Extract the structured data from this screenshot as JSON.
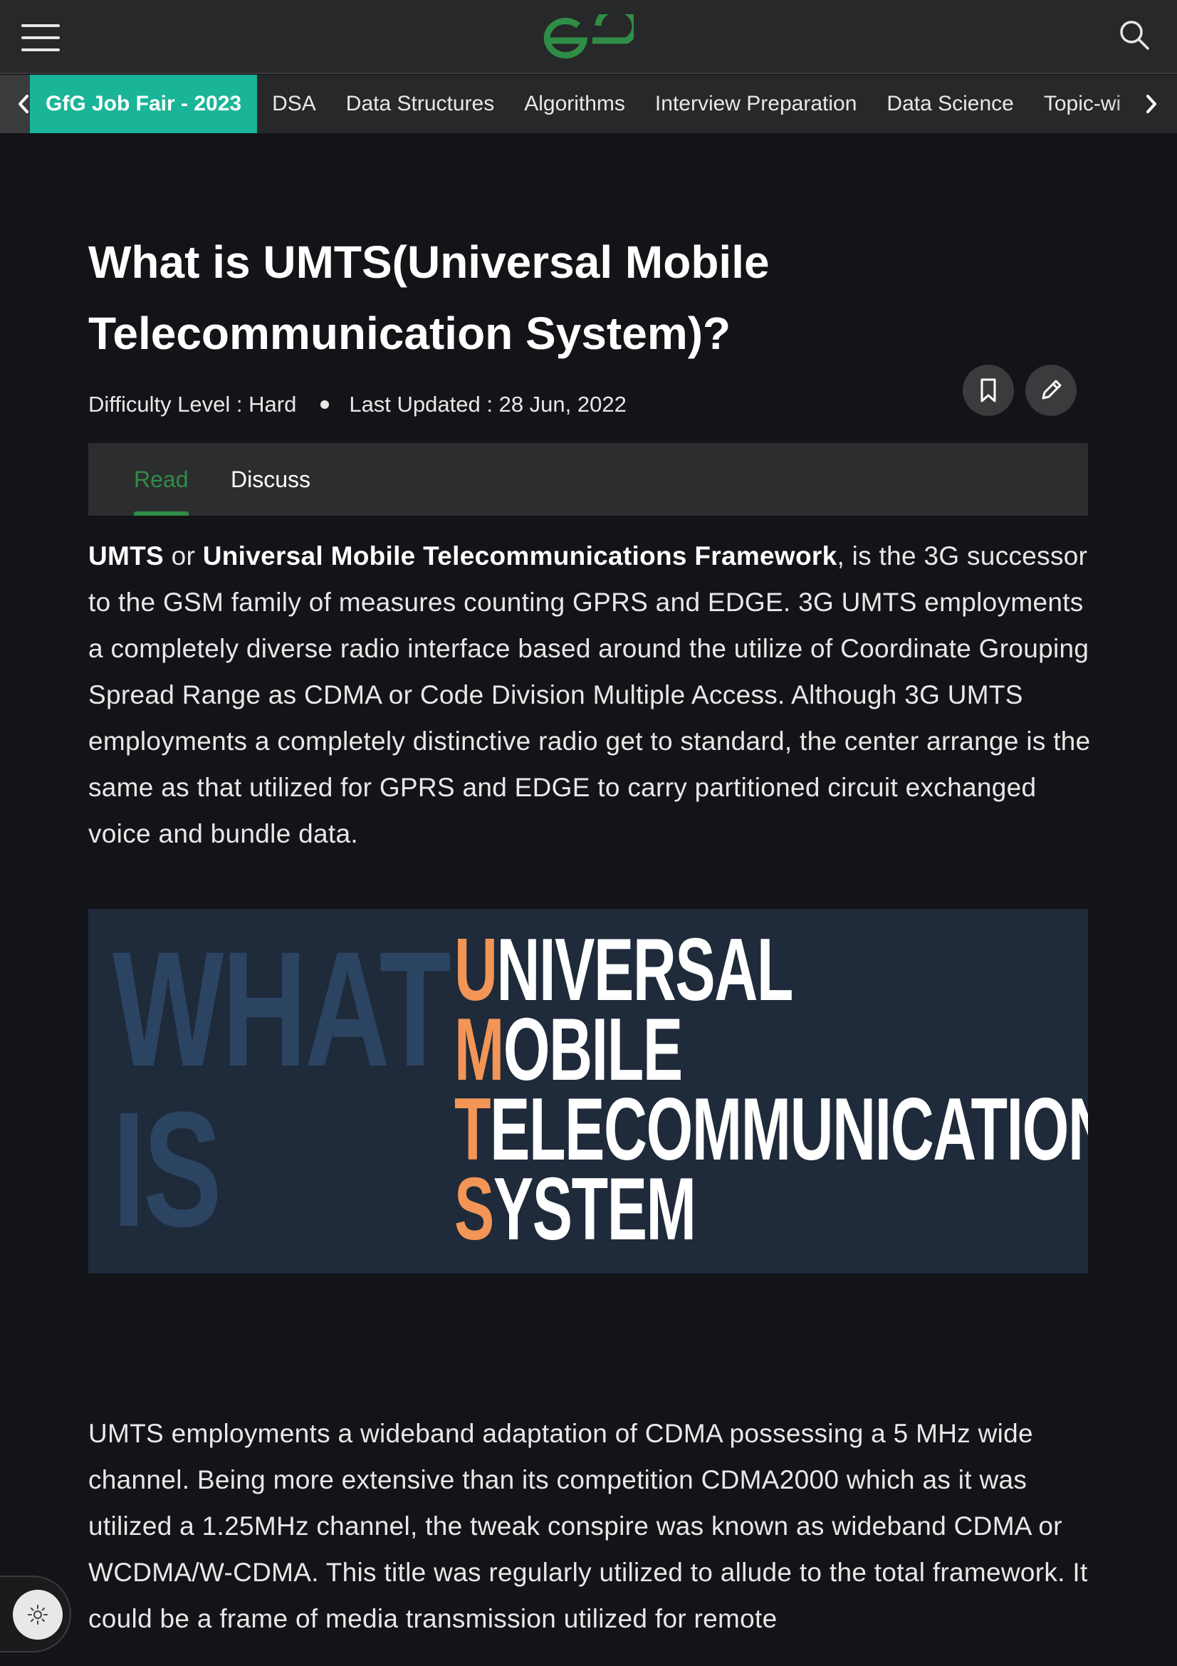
{
  "header": {
    "menu_icon": "hamburger-menu-icon",
    "logo_icon": "gfg-logo-icon",
    "search_icon": "search-icon",
    "accent_color": "#2f8d46"
  },
  "nav": {
    "left_arrow_icon": "chevron-left-icon",
    "right_arrow_icon": "chevron-right-icon",
    "items": [
      {
        "label": "GfG Job Fair - 2023",
        "active": true
      },
      {
        "label": "DSA"
      },
      {
        "label": "Data Structures"
      },
      {
        "label": "Algorithms"
      },
      {
        "label": "Interview Preparation"
      },
      {
        "label": "Data Science"
      },
      {
        "label": "Topic-wi"
      }
    ],
    "active_color": "#1ab598"
  },
  "article": {
    "title": "What is UMTS(Universal Mobile Telecommunication System)?",
    "difficulty": "Difficulty Level : Hard",
    "last_updated": "Last Updated : 28 Jun, 2022",
    "bookmark_icon": "bookmark-icon",
    "edit_icon": "pencil-icon",
    "tabs": {
      "read": "Read",
      "discuss": "Discuss"
    },
    "para1": {
      "term1": "UMTS",
      "or": " or ",
      "term2": "Universal Mobile Telecommunications Framework",
      "rest": ", is the 3G successor to the GSM family of measures counting GPRS and EDGE. 3G UMTS employments a completely diverse radio interface based around the utilize of Coordinate Grouping Spread Range as CDMA or Code Division Multiple Access. Although 3G UMTS employments a completely distinctive radio get to standard, the center arrange is the same as that utilized for GPRS and EDGE to carry partitioned circuit exchanged voice and bundle data."
    },
    "banner": {
      "what": "WHAT",
      "is": "IS",
      "lines": [
        {
          "first": "U",
          "rest": "NIVERSAL"
        },
        {
          "first": "M",
          "rest": "OBILE"
        },
        {
          "first": "T",
          "rest": "ELECOMMUNICATION"
        },
        {
          "first": "S",
          "rest": "YSTEM"
        }
      ],
      "accent_color": "#f29556"
    },
    "para2": "UMTS employments a wideband adaptation of CDMA possessing a 5 MHz wide channel. Being more extensive than its competition CDMA2000 which as it was utilized a 1.25MHz channel, the tweak conspire was known as wideband CDMA or WCDMA/W-CDMA. This title was regularly utilized to allude to the total framework. It could be a frame of media transmission utilized for remote"
  },
  "theme_toggle_icon": "sun-icon"
}
